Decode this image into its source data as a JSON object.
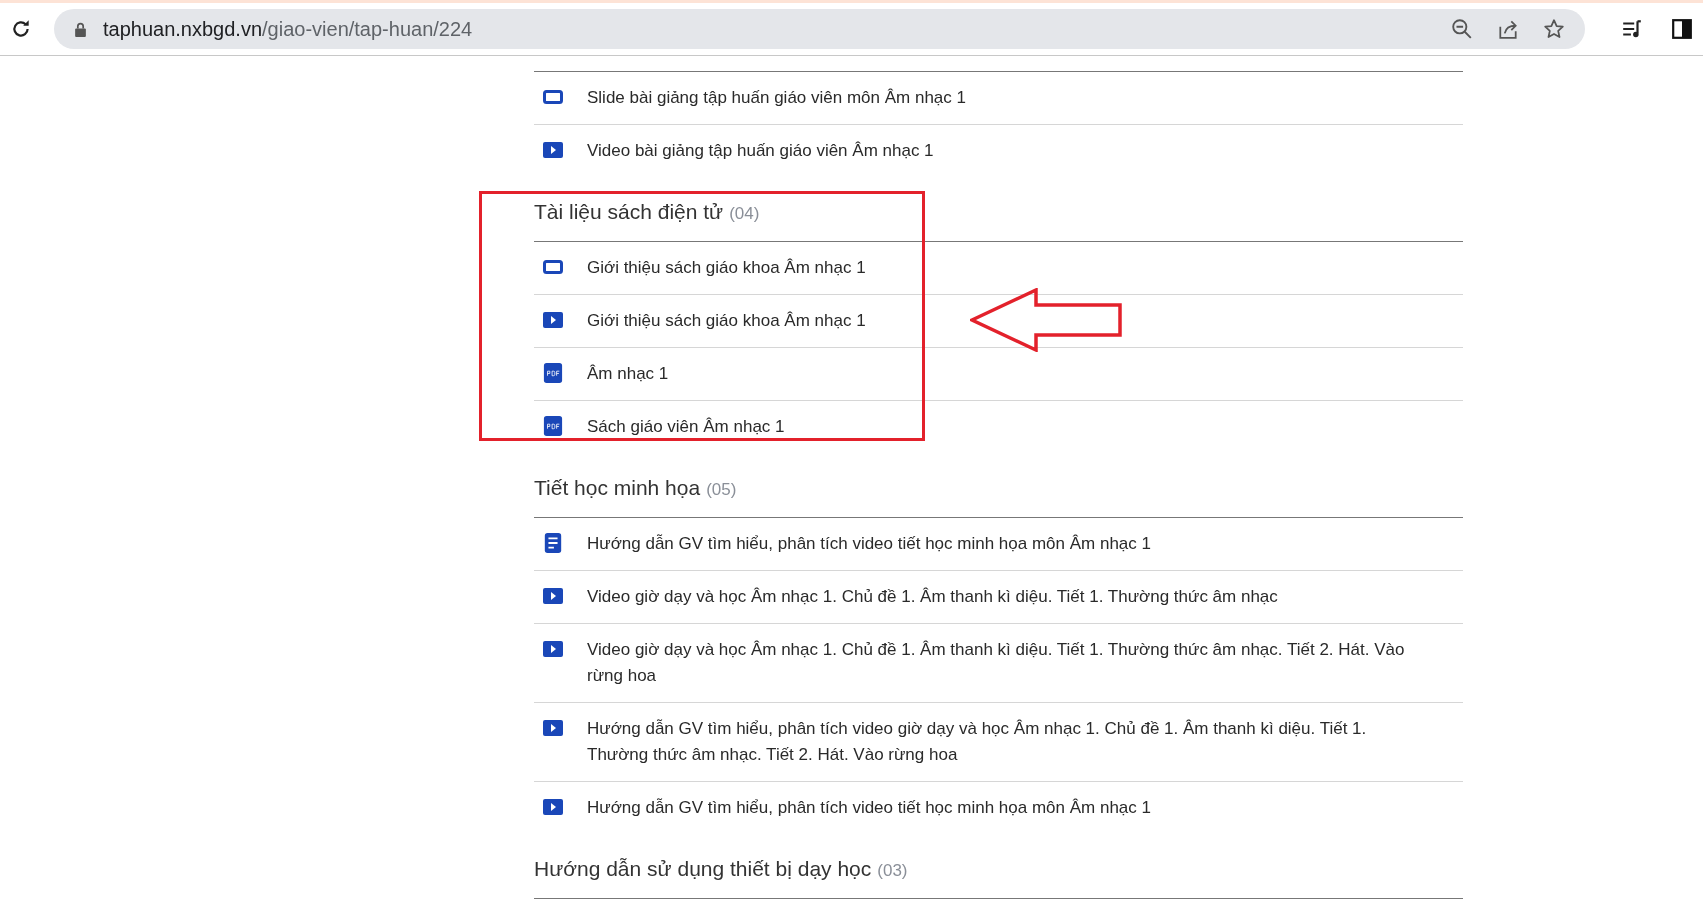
{
  "browser": {
    "url_host": "taphuan.nxbgd.vn",
    "url_path": "/giao-vien/tap-huan/224"
  },
  "sections": [
    {
      "items": [
        {
          "kind": "slide",
          "text": "Slide bài giảng tập huấn giáo viên môn Âm nhạc 1"
        },
        {
          "kind": "video",
          "text": "Video bài giảng tập huấn giáo viên Âm nhạc 1"
        }
      ]
    },
    {
      "title": "Tài liệu sách điện tử",
      "count": "(04)",
      "highlighted": true,
      "items": [
        {
          "kind": "slide",
          "text": "Giới thiệu sách giáo khoa Âm nhạc 1"
        },
        {
          "kind": "video",
          "text": "Giới thiệu sách giáo khoa Âm nhạc 1"
        },
        {
          "kind": "pdf",
          "text": "Âm nhạc 1"
        },
        {
          "kind": "pdf",
          "text": "Sách giáo viên Âm nhạc 1"
        }
      ]
    },
    {
      "title": "Tiết học minh họa",
      "count": "(05)",
      "highlighted": false,
      "items": [
        {
          "kind": "doc",
          "text": "Hướng dẫn GV tìm hiểu, phân tích video tiết học minh họa môn Âm nhạc 1"
        },
        {
          "kind": "video",
          "text": "Video giờ dạy và học Âm nhạc 1. Chủ đề 1. Âm thanh kì diệu. Tiết 1. Thường thức âm nhạc"
        },
        {
          "kind": "video",
          "text": "Video giờ dạy và học Âm nhạc 1. Chủ đề 1. Âm thanh kì diệu. Tiết 1. Thường thức âm nhạc. Tiết 2. Hát. Vào rừng hoa"
        },
        {
          "kind": "video",
          "text": "Hướng dẫn GV tìm hiểu, phân tích video giờ dạy và học Âm nhạc 1. Chủ đề 1. Âm thanh kì diệu. Tiết 1. Thường thức âm nhạc. Tiết 2. Hát. Vào rừng hoa"
        },
        {
          "kind": "video",
          "text": "Hướng dẫn GV tìm hiểu, phân tích video tiết học minh họa môn Âm nhạc 1"
        }
      ]
    },
    {
      "title": "Hướng dẫn sử dụng thiết bị dạy học",
      "count": "(03)",
      "highlighted": false
    }
  ]
}
